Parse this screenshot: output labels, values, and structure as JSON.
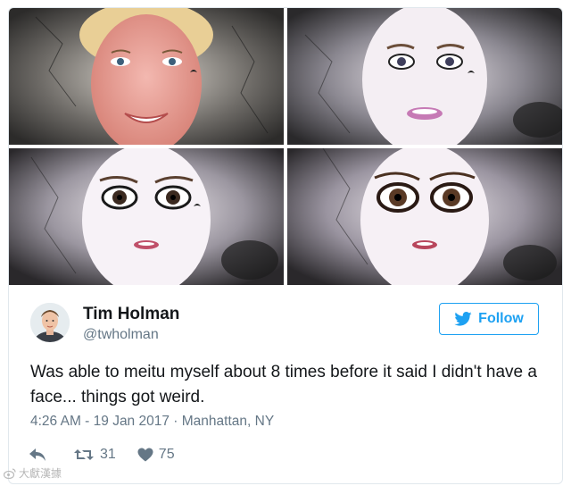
{
  "tweet": {
    "author_name": "Tim Holman",
    "author_handle": "@twholman",
    "follow_label": "Follow",
    "text": "Was able to meitu myself about 8 times before it said I didn't have a face... things got weird.",
    "time": "4:26 AM - 19 Jan 2017",
    "separator": "·",
    "location": "Manhattan, NY",
    "retweet_count": "31",
    "like_count": "75"
  },
  "photos": [
    {
      "alt": "meitu-stage-1"
    },
    {
      "alt": "meitu-stage-2"
    },
    {
      "alt": "meitu-stage-3"
    },
    {
      "alt": "meitu-stage-4"
    }
  ],
  "watermark": {
    "text": "大獻漢據"
  },
  "colors": {
    "accent": "#1da1f2",
    "muted": "#657786",
    "text": "#14171a",
    "border": "#e1e8ed"
  }
}
